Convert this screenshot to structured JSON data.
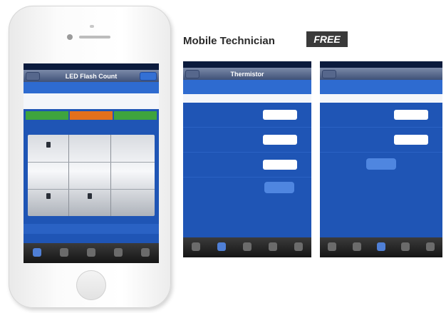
{
  "heading": {
    "title": "Mobile Technician",
    "badge": "FREE"
  },
  "led": {
    "status": "",
    "title": "LED Flash Count",
    "banner": "",
    "info": "",
    "tabs": [
      "",
      "",
      ""
    ],
    "footer": "",
    "tabbar": [
      "",
      "",
      "",
      "",
      ""
    ]
  },
  "thermistor": {
    "title": "Thermistor",
    "banner": "",
    "row": "",
    "fields": [
      {
        "label": "",
        "unit": ""
      },
      {
        "label": "",
        "unit": ""
      },
      {
        "label": "",
        "unit": ""
      }
    ],
    "button": "",
    "footer": "",
    "tabbar": [
      "",
      "",
      "",
      "",
      ""
    ]
  },
  "pressure": {
    "title": "",
    "banner": "",
    "row": "",
    "fields": [
      {
        "label": "",
        "unit": ""
      },
      {
        "label": "",
        "unit": ""
      }
    ],
    "button": "",
    "footer": "",
    "tabbar": [
      "",
      "",
      "",
      "",
      ""
    ]
  },
  "colors": {
    "accent": "#1f55b5",
    "tab_green": "#3ea43e",
    "tab_orange": "#e4701c"
  }
}
